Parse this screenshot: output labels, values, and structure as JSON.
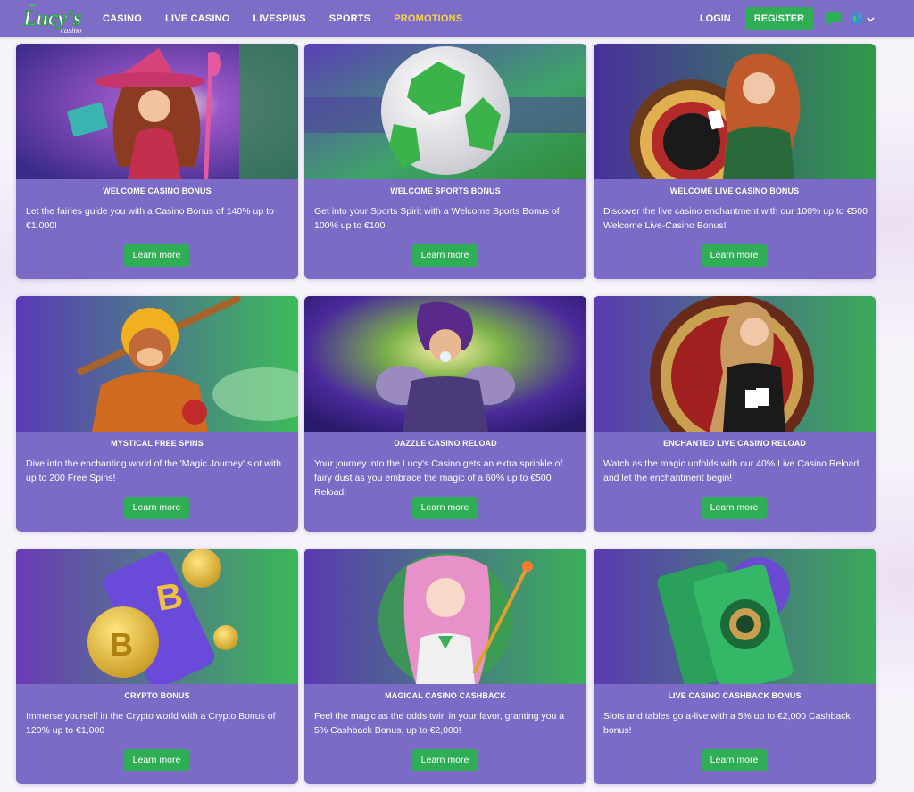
{
  "header": {
    "logo_text": "Lucy's",
    "logo_sub": "casino",
    "nav": [
      {
        "label": "CASINO"
      },
      {
        "label": "LIVE CASINO"
      },
      {
        "label": "LIVESPINS"
      },
      {
        "label": "SPORTS"
      },
      {
        "label": "PROMOTIONS",
        "active": true
      }
    ],
    "login_label": "LOGIN",
    "register_label": "REGISTER",
    "icons": [
      "chat-icon",
      "globe-icon",
      "chevron-down-icon"
    ]
  },
  "colors": {
    "header_bg": "#7e6dc6",
    "card_bg": "#7b6ac6",
    "button_green": "#2fae55",
    "active_nav": "#f6d44a"
  },
  "promos": [
    {
      "title": "WELCOME CASINO BONUS",
      "desc": "Let the fairies guide you with a Casino Bonus of 140% up to €1.000!",
      "button": "Learn more"
    },
    {
      "title": "WELCOME SPORTS BONUS",
      "desc": "Get into your Sports Spirit with a Welcome Sports Bonus of 100% up to €100",
      "button": "Learn more"
    },
    {
      "title": "WELCOME LIVE CASINO BONUS",
      "desc": "Discover the live casino enchantment with our 100% up to €500 Welcome Live-Casino Bonus!",
      "button": "Learn more"
    },
    {
      "title": "MYSTICAL FREE SPINS",
      "desc": "Dive into the enchanting world of the 'Magic Journey' slot with up to 200 Free Spins!",
      "button": "Learn more"
    },
    {
      "title": "DAZZLE CASINO RELOAD",
      "desc": "Your journey into the Lucy's Casino gets an extra sprinkle of fairy dust as you embrace the magic of a 60% up to €500 Reload!",
      "button": "Learn more"
    },
    {
      "title": "ENCHANTED LIVE CASINO RELOAD",
      "desc": "Watch as the magic unfolds with our 40% Live Casino Reload and let the enchantment begin!",
      "button": "Learn more"
    },
    {
      "title": "CRYPTO BONUS",
      "desc": "Immerse yourself in the Crypto world with a Crypto Bonus of 120% up to €1,000",
      "button": "Learn more"
    },
    {
      "title": "MAGICAL CASINO CASHBACK",
      "desc": "Feel the magic as the odds twirl in your favor, granting you a 5% Cashback Bonus, up to €2,000!",
      "button": "Learn more"
    },
    {
      "title": "LIVE CASINO CASHBACK BONUS",
      "desc": "Slots and tables go a-live with a 5% up to €2,000 Cashback bonus!",
      "button": "Learn more"
    }
  ]
}
